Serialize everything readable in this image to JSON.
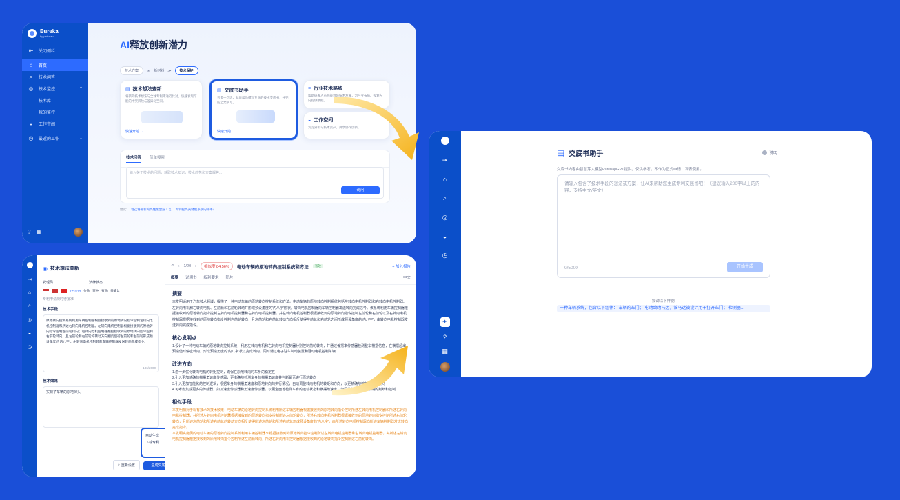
{
  "brand": {
    "name": "Eureka",
    "sub": "by patsnap"
  },
  "panel1": {
    "menu": [
      {
        "icon": "⇤",
        "label": "关闭侧栏"
      },
      {
        "icon": "⌂",
        "label": "首页"
      },
      {
        "icon": "⌕",
        "label": "技术问答"
      },
      {
        "icon": "◎",
        "label": "技术监控"
      },
      {
        "icon": "",
        "label": "技术库"
      },
      {
        "icon": "",
        "label": "我的监控"
      },
      {
        "icon": "◒",
        "label": "工作空间"
      },
      {
        "icon": "◷",
        "label": "最近的工作"
      }
    ],
    "headline_ai": "AI",
    "headline": "释放创新潜力",
    "steps": [
      "技术方案",
      "新材料",
      "技术保护"
    ],
    "step_sep": "≫",
    "cards": {
      "idea": {
        "title": "技术想法查新",
        "desc": "将新的技术想法与全球专利库进行比对，快速发现可能的冲突风险与差异化空间。",
        "link": "快速开始 →"
      },
      "disclosure": {
        "title": "交底书助手",
        "desc": "只需一句话，就能帮你撰写专业的技术交底书，并完成全文撰写。",
        "link": "快速开始 →"
      },
      "route": {
        "title": "行业技术路线",
        "desc": "帮助研发人员把握领域技术发展，为产业布局、规划方向提供依据。"
      },
      "workspace": {
        "title": "工作空间",
        "desc": "沉淀分析与技术资产，共享协作创新。"
      }
    },
    "tabs": [
      "技术问答",
      "简单搜索"
    ],
    "qa_placeholder": "输入关于技术的问题，获取技术知识，技术趋势和方案解答...",
    "ask_button": "询问",
    "try_label": "尝试:",
    "suggestions": [
      "锂这将最新的高性能合成工艺",
      "如何提高光储能系统的效率？"
    ]
  },
  "panel2": {
    "title": "交底书助手",
    "help": "说明",
    "notice": "交底书内容由智慧芽大模型PatsnapGPT提供，仅供参考，不作为正式申请、发表使用。",
    "placeholder": "请输入包含了技术手段的想法或方案，让AI来帮助您生成专利交底书吧！（建议输入200字以上的内容，支持中文/英文）",
    "counter": "0/5000",
    "generate": "开始生成",
    "try_label": "尝试以下样例:",
    "example": "一种车辆系统，包含以下组件：  车辆的车门；  电动致动马达，该马达被设计用于打开车门；  检测器..."
  },
  "panel3": {
    "title": "技术想法查新",
    "labels": {
      "office": "受理局",
      "status": "法律状态"
    },
    "filters": [
      "172/172",
      "失效",
      "审中",
      "有效",
      "未确认"
    ],
    "note": "专利申请随时待批准",
    "tech_label": "技术手段",
    "tech_text": "原地转向控制系统利用车辆控制器根据接收到的原地转向指令控制左转向电机控制器和所述右转向电机控制器。左转向电机控制器根据接收到的原地转向指令控制左前轮转向；右转向电机控制器根据接收到的原地转向指令控制右前轮转向。且左前轮和右前轮的转动方向相反使得左前轮和右前轮形成预设角度的'内八字'，由转向电机控制转向车辆控制器发送转向完成指令。",
    "tech_count": "186/2000",
    "effect_label": "技术效果",
    "effect_text": "实现了车辆的原地掉头",
    "reset": "重新设置",
    "popup": [
      "自动生成",
      "下载专利"
    ],
    "generate": "生成交底书",
    "nav_count": "1/20",
    "similarity": "相似度 84.56%",
    "doc_title": "电动车辆的原地转向控制系统和方法",
    "doc_badge": "有效",
    "add": "+ 加入报告",
    "doc_tabs": [
      "概要",
      "说明书",
      "权利要求",
      "图片"
    ],
    "lang": "中文",
    "abstract_title": "摘要",
    "abstract": "本发明适用于汽车技术领域，提供了一种电动车辆的原地转向控制系统和方法。电动车辆的原地转向控制系统包括左转向电机控制器和右转向电机控制器、左转向电机和右转向电机、左前轮和右前轮转动并形成预设角度的'内八字'形状。转向电机控制器向车辆控制器发送转向完成信号。该系统利用车辆控制器根据接收到的原地转向指令控制左转向电机控制器和右转向电机控制器，并左转向电机控制器根据接收到的原地转向指令控制左前轮和右前轮以及右转向电机控制器根据接收到的原地转向指令控制右前轮转向，且左前轮和右前轮转动方向相反使得左前轮和右前轮之间形成预设角度的'内八字'，由转向电机控制器发送转向完成指令。",
    "core_title": "核心发明点",
    "core": "1.设计了一种电动车辆的原地转向控制系统，利用左转向电机和右转向电机控制器分别控制前轮转向，并通过偏摆率传感器检测整车横摆信息，在横摆超出预设值时停止转向，形成预设角度的'内八字'状以完成转向。同时通过电子驻车制动装置和驱动电机控制车辆",
    "improve_title": "改进方向",
    "improve": [
      "1.进一步优化转向电机的转矩控制，确保在原地转向时车身的稳定性",
      "2.引入更加精确的横摆角速度传感器，更准确地检测车身的横摆角速度并判断是否进行原地转向",
      "3.引入更加智能化的控制逻辑，根据车身的横摆角速度和原地转向的执行情况，自动调整转向电机的转矩和方向，以更精确地控制车身的转向",
      "4.可考虑集成更多的传感器，如加速度传感器和角速度传感器，以更全面地检测车身的运动状态和横摆角速度，为原地转向提供更精确的判断和控制"
    ],
    "similar_title": "相似手段",
    "similar": [
      "本发明相对于现有技术的技术效果：电动车辆的原地转向控制系统利用所述车辆控制器根据接收到的原地转向指令控制所述左转向电机控制器和所述右转向电机控制器，并所述左转向电机控制器根据接收到的原地转向指令控制所述左前轮转向，所述右转向电机控制器根据接收到的原地转向指令控制所述右前轮转向，且所述左前轮和所述右前轮的转动方向相反使得所述左前轮和所述右前轮形成预设角度的'内八字'，由所述转向电机控制器向所述车辆控制器发送转向完成指令。",
      "本发明实施例的电动车辆的原地转向控制系统利用车辆控制器30根据接收到的原地转向指令控制所述左转向电机控制器和右转向电机控制器，并所述左转向电机控制器根据接收到的原地转向指令控制所述左前轮转向，所述右转向电机控制器根据接收到的原地转向指令控制所述右前轮转向。"
    ]
  },
  "colors": {
    "accent": "#2d6bff",
    "background": "#1a4fd8",
    "sidebar": "#0b4fc9",
    "highlight": "#e88a22"
  }
}
